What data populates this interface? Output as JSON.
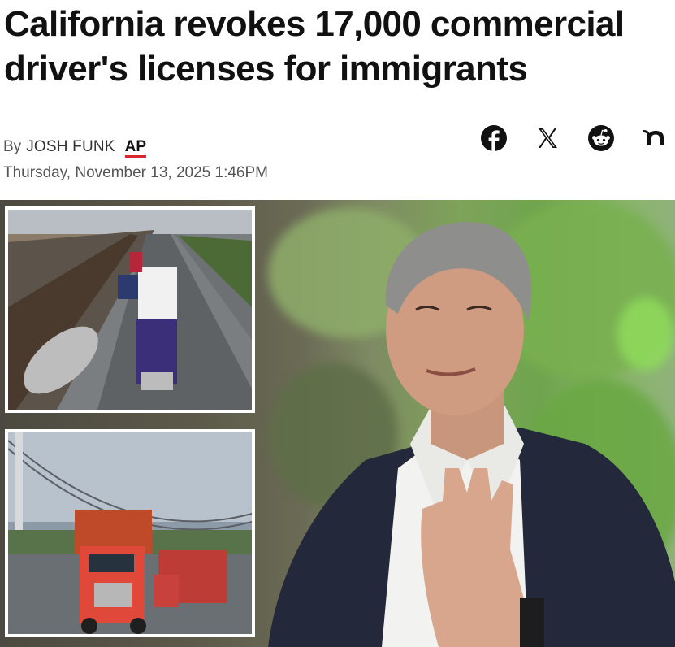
{
  "article": {
    "headline": "California revokes 17,000 commercial driver's licenses for immigrants",
    "byline_prefix": "By",
    "author": "JOSH FUNK",
    "agency": "AP",
    "date": "Thursday, November 13, 2025 1:46PM"
  },
  "share": {
    "icons": [
      "facebook-icon",
      "x-icon",
      "reddit-icon",
      "nextdoor-icon"
    ]
  },
  "colors": {
    "agency_underline": "#d8262d",
    "text": "#111111",
    "meta": "#555555"
  }
}
